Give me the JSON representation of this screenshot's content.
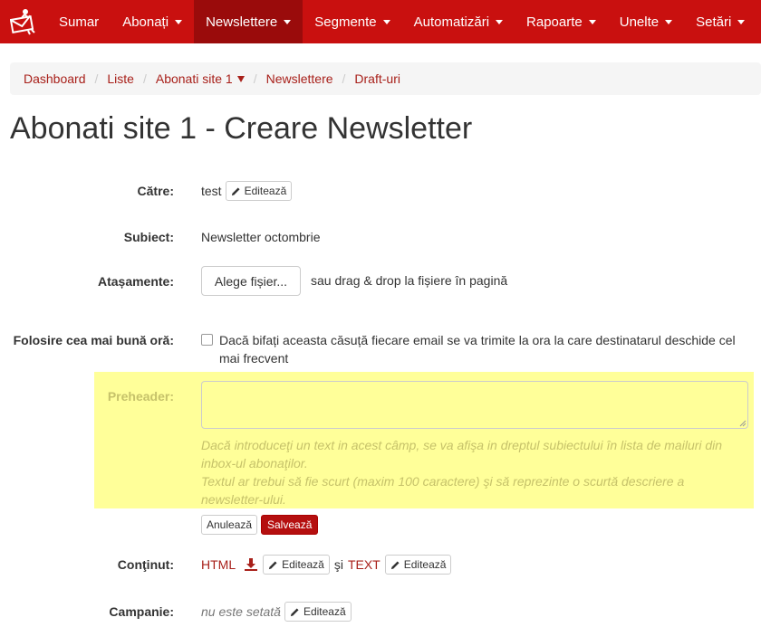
{
  "navbar": {
    "items": [
      {
        "label": "Sumar",
        "dropdown": false
      },
      {
        "label": "Abonați",
        "dropdown": true
      },
      {
        "label": "Newslettere",
        "dropdown": true,
        "active": true
      },
      {
        "label": "Segmente",
        "dropdown": true
      },
      {
        "label": "Automatizări",
        "dropdown": true
      },
      {
        "label": "Rapoarte",
        "dropdown": true
      },
      {
        "label": "Unelte",
        "dropdown": true
      },
      {
        "label": "Setări",
        "dropdown": true
      }
    ]
  },
  "breadcrumb": [
    "Dashboard",
    "Liste",
    "Abonati site 1",
    "Newslettere",
    "Draft-uri"
  ],
  "page_title": "Abonati site 1 - Creare Newsletter",
  "form": {
    "to": {
      "label": "Către:",
      "value": "test",
      "edit_label": "Editează"
    },
    "subject": {
      "label": "Subiect:",
      "value": "Newsletter octombrie"
    },
    "attachments": {
      "label": "Atașamente:",
      "button": "Alege fișier...",
      "hint": "sau drag & drop la fișiere în pagină"
    },
    "best_time": {
      "label": "Folosire cea mai bună oră:",
      "text": "Dacă bifați aceasta căsuță fiecare email se va trimite la ora la care destinatarul deschide cel mai frecvent",
      "checked": false
    },
    "preheader": {
      "label": "Preheader:",
      "value": "",
      "help_line1": "Dacă introduceţi un text in acest câmp, se va afişa in dreptul subiectului în lista de mailuri din inbox-ul abonaţilor.",
      "help_line2": "Textul ar trebui să fie scurt (maxim 100 caractere) şi să reprezinte o scurtă descriere a newsletter-ului.",
      "cancel_label": "Anulează",
      "save_label": "Salvează"
    },
    "content": {
      "label": "Conţinut:",
      "html_label": "HTML",
      "edit_label": "Editează",
      "and_label": "şi",
      "text_label": "TEXT",
      "edit_label_2": "Editează"
    },
    "campaign": {
      "label": "Campanie:",
      "value": "nu este setată",
      "edit_label": "Editează"
    }
  },
  "colors": {
    "navbar": "#c9100f",
    "nav_active": "#9a0b0b",
    "link": "#a8201a",
    "highlight": "#ffff99",
    "save_button": "#b50f0f"
  }
}
